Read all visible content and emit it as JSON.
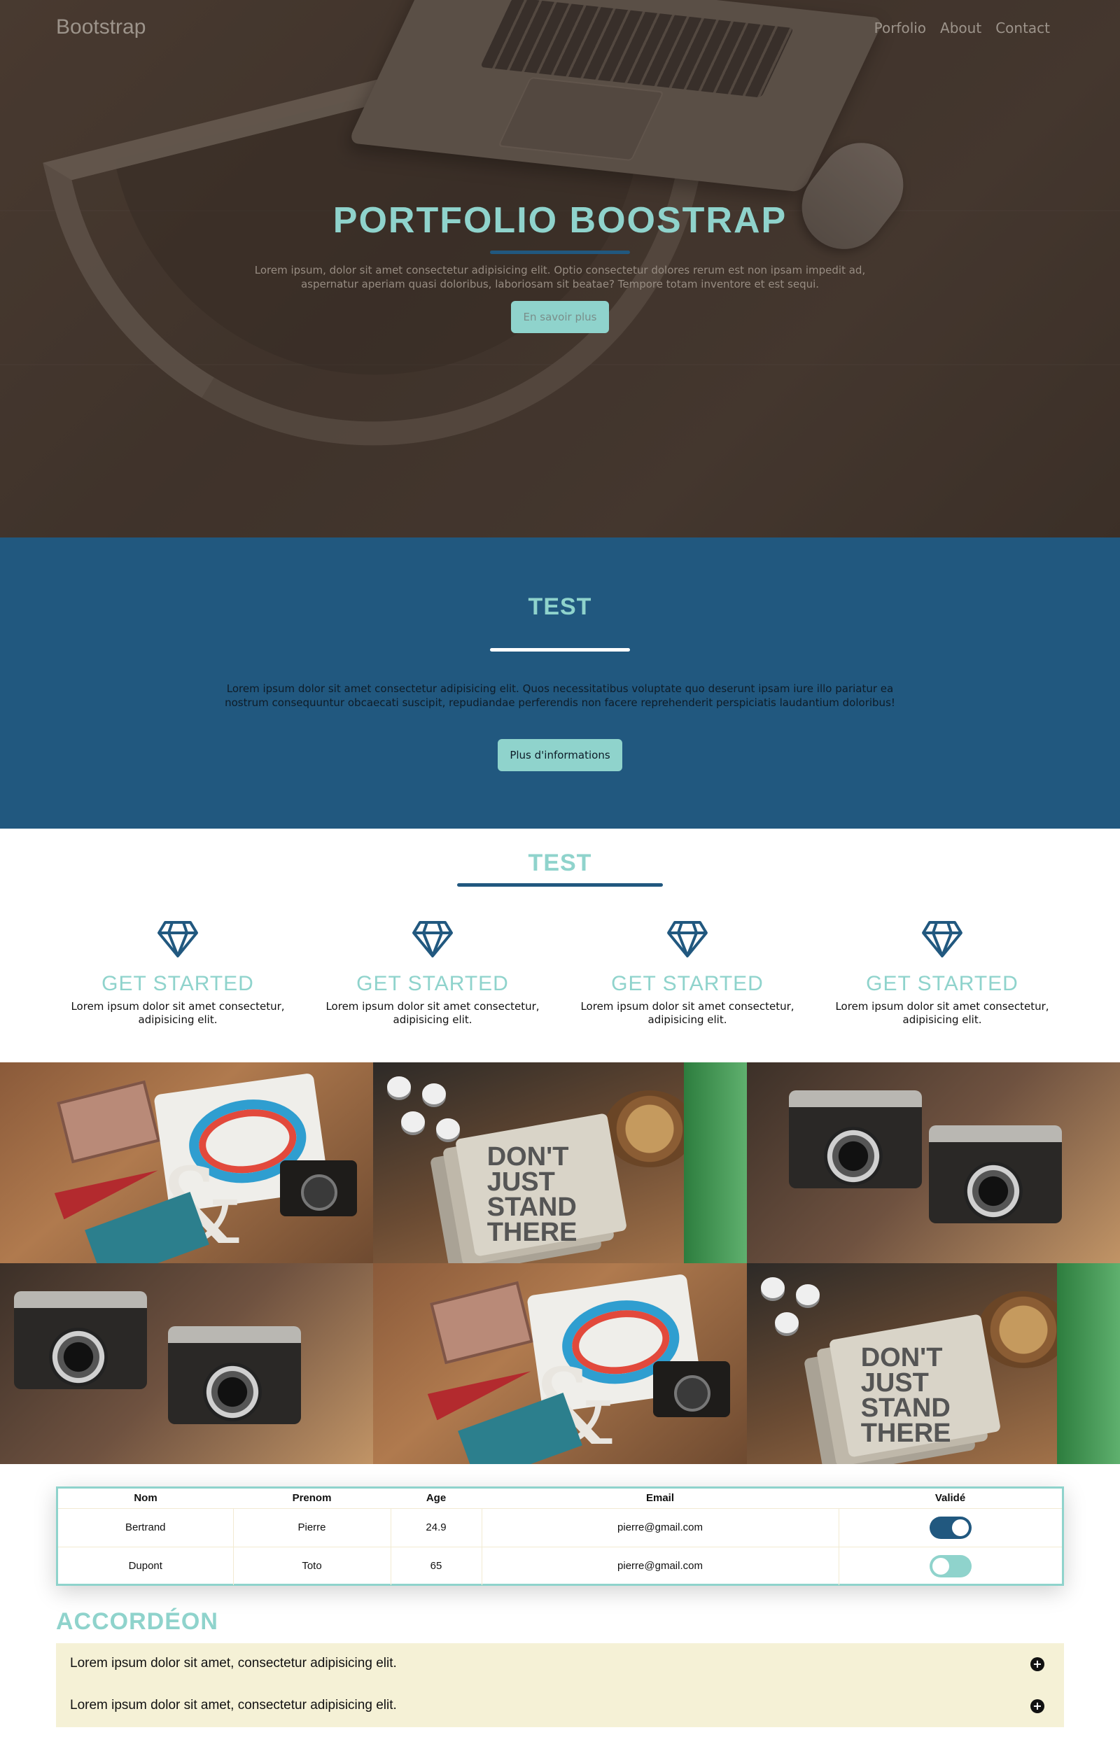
{
  "navbar": {
    "brand": "Bootstrap",
    "links": [
      "Porfolio",
      "About",
      "Contact"
    ]
  },
  "hero": {
    "title": "PORTFOLIO BOOSTRAP",
    "text": "Lorem ipsum, dolor sit amet consectetur adipisicing elit. Optio consectetur dolores rerum est non ipsam impedit ad, aspernatur aperiam quasi doloribus, laboriosam sit beatae? Tempore totam inventore et est sequi.",
    "button": "En savoir plus"
  },
  "blue_section": {
    "title": "TEST",
    "text": "Lorem ipsum dolor sit amet consectetur adipisicing elit. Quos necessitatibus voluptate quo deserunt ipsam iure illo pariatur ea nostrum consequuntur obcaecati suscipit, repudiandae perferendis non facere reprehenderit perspiciatis laudantium doloribus!",
    "button": "Plus d'informations"
  },
  "features": {
    "title": "TEST",
    "items": [
      {
        "icon": "diamond-icon",
        "title": "GET STARTED",
        "text": "Lorem ipsum dolor sit amet consectetur, adipisicing elit."
      },
      {
        "icon": "diamond-icon",
        "title": "GET STARTED",
        "text": "Lorem ipsum dolor sit amet consectetur, adipisicing elit."
      },
      {
        "icon": "diamond-icon",
        "title": "GET STARTED",
        "text": "Lorem ipsum dolor sit amet consectetur, adipisicing elit."
      },
      {
        "icon": "diamond-icon",
        "title": "GET STARTED",
        "text": "Lorem ipsum dolor sit amet consectetur, adipisicing elit."
      }
    ]
  },
  "gallery": {
    "notebook_text": "DON'T JUST STAND THERE"
  },
  "table": {
    "headers": [
      "Nom",
      "Prenom",
      "Age",
      "Email",
      "Validé"
    ],
    "rows": [
      {
        "nom": "Bertrand",
        "prenom": "Pierre",
        "age": "24.9",
        "email": "pierre@gmail.com",
        "valide": true
      },
      {
        "nom": "Dupont",
        "prenom": "Toto",
        "age": "65",
        "email": "pierre@gmail.com",
        "valide": false
      }
    ]
  },
  "accordion": {
    "title": "ACCORDÉON",
    "items": [
      "Lorem ipsum dolor sit amet, consectetur adipisicing elit.",
      "Lorem ipsum dolor sit amet, consectetur adipisicing elit."
    ]
  },
  "colors": {
    "accent": "#8fd3cc",
    "primary": "#21587f",
    "accordion_bg": "#f5f1d6"
  }
}
